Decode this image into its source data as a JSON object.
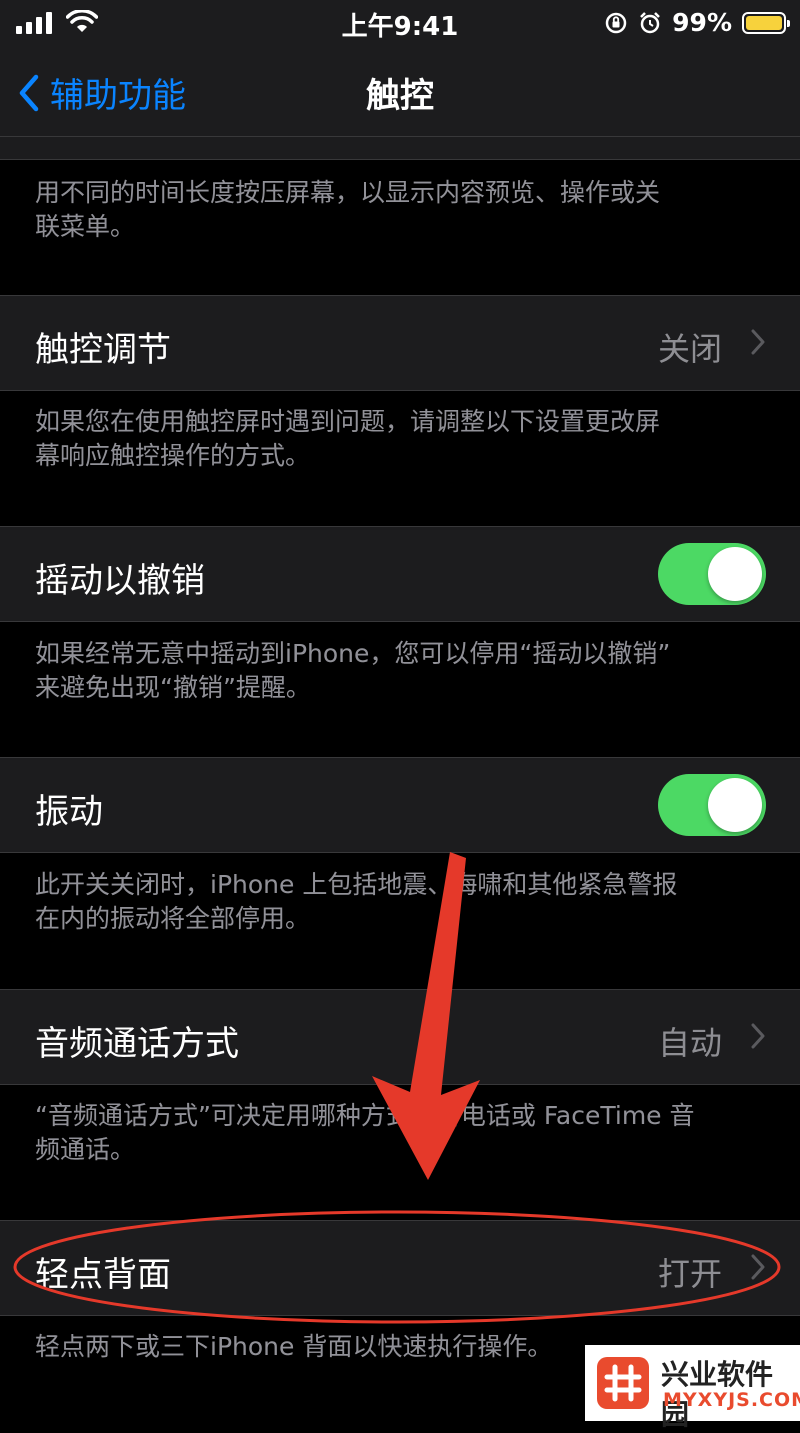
{
  "status_bar": {
    "time": "上午9:41",
    "battery_percent": "99%",
    "battery_level": 0.99,
    "battery_color": "#f7d23c",
    "icons": [
      "signal-icon",
      "wifi-icon",
      "orientation-lock-icon",
      "alarm-icon",
      "battery-icon"
    ]
  },
  "nav": {
    "back_label": "辅助功能",
    "title": "触控",
    "accent_color": "#0a84ff"
  },
  "sections": {
    "haptic_touch_footer_line1": "用不同的时间长度按压屏幕，以显示内容预览、操作或关",
    "haptic_touch_footer_line2": "联菜单。",
    "touch_accommodations_label": "触控调节",
    "touch_accommodations_value": "关闭",
    "touch_accommodations_footer_line1": "如果您在使用触控屏时遇到问题，请调整以下设置更改屏",
    "touch_accommodations_footer_line2": "幕响应触控操作的方式。",
    "shake_to_undo_label": "摇动以撤销",
    "shake_to_undo_on": true,
    "shake_to_undo_footer_line1": "如果经常无意中摇动到iPhone，您可以停用“摇动以撤销”",
    "shake_to_undo_footer_line2": "来避免出现“撤销”提醒。",
    "vibration_label": "振动",
    "vibration_on": true,
    "vibration_footer_line1": "此开关关闭时，iPhone 上包括地震、海啸和其他紧急警报",
    "vibration_footer_line2": "在内的振动将全部停用。",
    "call_audio_routing_label": "音频通话方式",
    "call_audio_routing_value": "自动",
    "call_audio_routing_footer_line1": "“音频通话方式”可决定用哪种方式接听电话或 FaceTime 音",
    "call_audio_routing_footer_line2": "频通话。",
    "back_tap_label": "轻点背面",
    "back_tap_value": "打开",
    "back_tap_footer": "轻点两下或三下iPhone 背面以快速执行操作。",
    "toggle_color": "#4cd964"
  },
  "annotation": {
    "arrow_color": "#e5392a",
    "circle_color": "#e5392a"
  },
  "watermark": {
    "name": "兴业软件园",
    "url": "MYXYJS.COM",
    "logo_color": "#e94b2e"
  }
}
